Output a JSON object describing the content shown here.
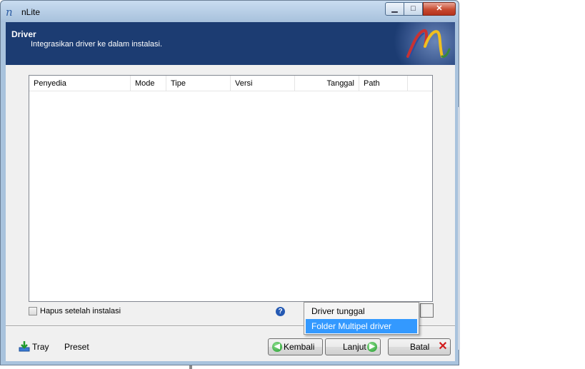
{
  "window": {
    "title": "nLite"
  },
  "titlebar": {
    "min": "▁",
    "max": "□",
    "close": "✕"
  },
  "header": {
    "title": "Driver",
    "subtitle": "Integrasikan driver ke dalam instalasi."
  },
  "listview": {
    "columns": [
      "Penyedia",
      "Mode",
      "Tipe",
      "Versi",
      "Tanggal",
      "Path"
    ]
  },
  "options": {
    "remove_after_install": "Hapus setelah instalasi",
    "help_glyph": "?"
  },
  "menu": {
    "items": [
      "Driver tunggal",
      "Folder Multipel driver"
    ],
    "selected_index": 1
  },
  "footer": {
    "tray_label": "Tray",
    "preset_label": "Preset",
    "back_label": "Kembali",
    "next_label": "Lanjut",
    "cancel_label": "Batal",
    "back_arrow": "◀",
    "next_arrow": "▶",
    "cancel_glyph": "✕"
  }
}
